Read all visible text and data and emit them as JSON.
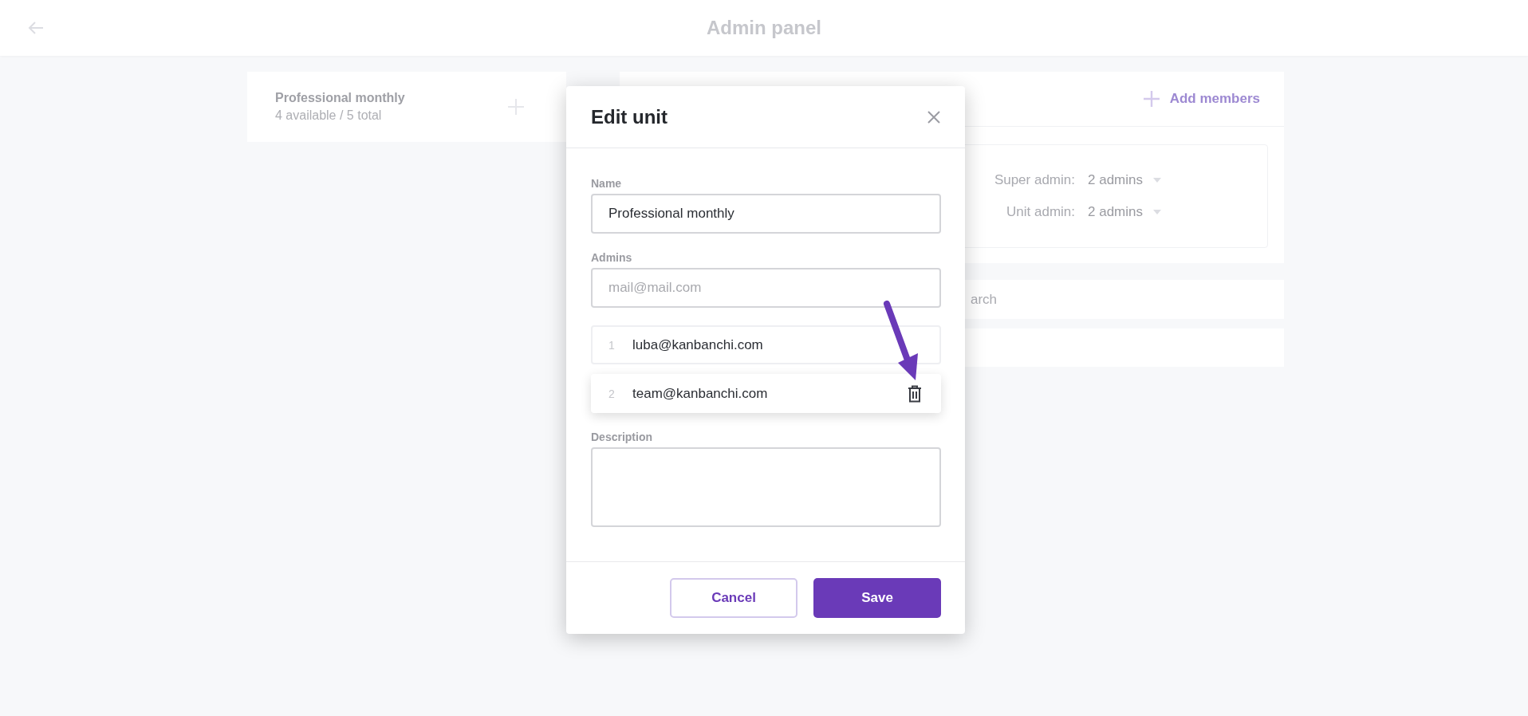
{
  "header": {
    "title": "Admin panel"
  },
  "unit_card": {
    "name": "Professional monthly",
    "availability": "4 available / 5 total"
  },
  "members_panel": {
    "add_button": "Add members",
    "roles": [
      {
        "label": "Super admin:",
        "value": "2 admins"
      },
      {
        "label": "Unit admin:",
        "value": "2 admins"
      }
    ],
    "search": {
      "placeholder": "arch"
    }
  },
  "dialog": {
    "title": "Edit unit",
    "name_label": "Name",
    "name_value": "Professional monthly",
    "admins_label": "Admins",
    "admins_placeholder": "mail@mail.com",
    "admins": [
      {
        "index": "1",
        "email": "luba@kanbanchi.com",
        "hovered": false
      },
      {
        "index": "2",
        "email": "team@kanbanchi.com",
        "hovered": true
      }
    ],
    "description_label": "Description",
    "buttons": [
      {
        "kind": "secondary",
        "label": "Cancel"
      },
      {
        "kind": "primary",
        "label": "Save"
      }
    ]
  }
}
